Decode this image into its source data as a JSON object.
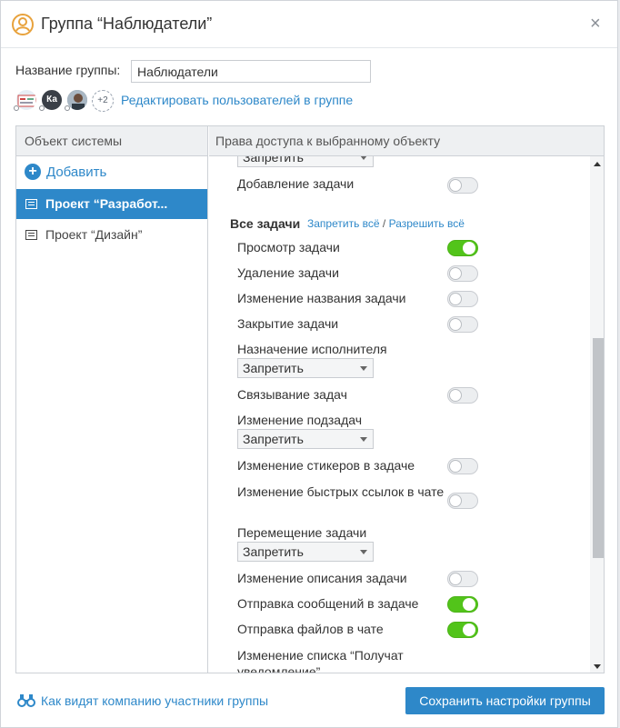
{
  "dialog": {
    "title": "Группа “Наблюдатели”",
    "close_symbol": "×",
    "name_label": "Название группы:",
    "name_value": "Наблюдатели",
    "more_users": "+2",
    "edit_users_link": "Редактировать пользователей в группе"
  },
  "left_panel": {
    "header": "Объект системы",
    "add_label": "Добавить",
    "projects": [
      {
        "label": "Проект “Разработ...",
        "active": true
      },
      {
        "label": "Проект “Дизайн”",
        "active": false
      }
    ]
  },
  "right_panel": {
    "header": "Права доступа к выбранному объекту",
    "top_select_value": "Запретить",
    "add_task_label": "Добавление задачи",
    "section_title": "Все задачи",
    "deny_all": "Запретить всё",
    "separator": "/",
    "allow_all": "Разрешить всё",
    "permissions": [
      {
        "label": "Просмотр задачи",
        "type": "toggle",
        "on": true
      },
      {
        "label": "Удаление задачи",
        "type": "toggle",
        "on": false
      },
      {
        "label": "Изменение названия задачи",
        "type": "toggle",
        "on": false
      },
      {
        "label": "Закрытие задачи",
        "type": "toggle",
        "on": false
      },
      {
        "label": "Назначение исполнителя",
        "type": "select",
        "value": "Запретить"
      },
      {
        "label": "Связывание задач",
        "type": "toggle",
        "on": false
      },
      {
        "label": "Изменение подзадач",
        "type": "select",
        "value": "Запретить"
      },
      {
        "label": "Изменение стикеров в задаче",
        "type": "toggle",
        "on": false
      },
      {
        "label": "Изменение быстрых ссылок в чате",
        "type": "toggle",
        "on": false
      },
      {
        "label": "Перемещение задачи",
        "type": "select",
        "value": "Запретить"
      },
      {
        "label": "Изменение описания задачи",
        "type": "toggle",
        "on": false
      },
      {
        "label": "Отправка сообщений в задаче",
        "type": "toggle",
        "on": true
      },
      {
        "label": "Отправка файлов в чате",
        "type": "toggle",
        "on": true
      },
      {
        "label": "Изменение списка “Получат уведомление”",
        "type": "text"
      }
    ]
  },
  "footer": {
    "visibility_link": "Как видят компанию участники группы",
    "save_button": "Сохранить настройки группы"
  },
  "colors": {
    "accent": "#2e88c9",
    "toggle_on": "#52c41a"
  },
  "icons": [
    "group-icon",
    "close-icon",
    "add-icon",
    "document-icon",
    "binoculars-icon",
    "caret-down-icon",
    "scroll-up-icon",
    "scroll-down-icon"
  ]
}
